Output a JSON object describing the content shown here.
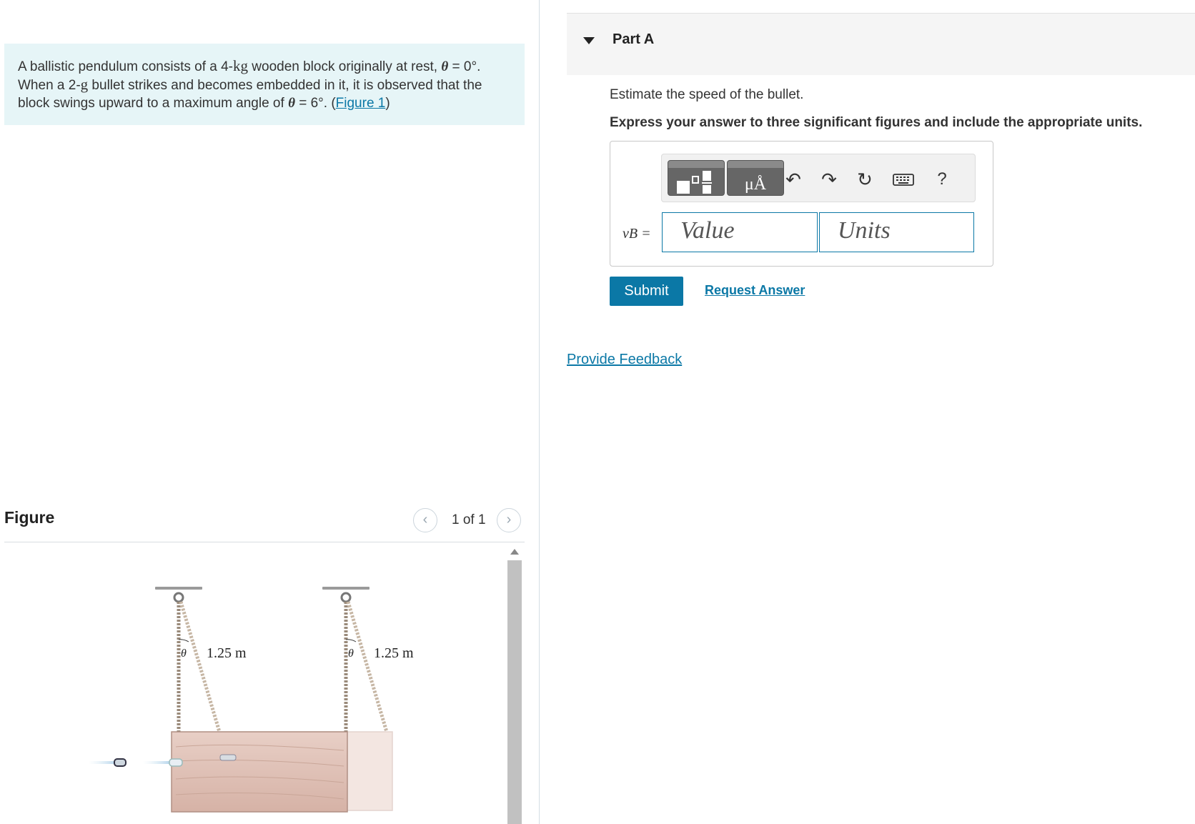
{
  "problem": {
    "t1": "A ballistic pendulum consists of a 4-",
    "t2": "kg",
    "t3": " wooden block originally at rest, ",
    "theta": "θ",
    "t4": " = 0°",
    "t5": ".",
    "t6": "When a 2-",
    "t7": "g",
    "t8": " bullet strikes and becomes embedded in it, it is observed that the",
    "t9": "block swings upward to a maximum angle of ",
    "t10": " = 6°",
    "t11": ". (",
    "figure_link": "Figure 1",
    "t12": ")"
  },
  "figure": {
    "title": "Figure",
    "pager_text": "1 of 1",
    "prev_icon": "‹",
    "next_icon": "›",
    "theta_label": "θ",
    "length_label": "1.25 m"
  },
  "part": {
    "title": "Part A",
    "question": "Estimate the speed of the bullet.",
    "instruction": "Express your answer to three significant figures and include the appropriate units."
  },
  "answer": {
    "variable": "vB =",
    "value_placeholder": "Value",
    "units_placeholder": "Units",
    "undo_icon": "↶",
    "redo_icon": "↷",
    "reset_icon": "↻",
    "help_icon": "?",
    "units_btn_text": "μÅ"
  },
  "actions": {
    "submit": "Submit",
    "request_answer": "Request Answer",
    "provide_feedback": "Provide Feedback"
  },
  "colors": {
    "accent": "#0b78a6",
    "problem_bg": "#e6f5f7",
    "header_bg": "#f5f5f5"
  }
}
